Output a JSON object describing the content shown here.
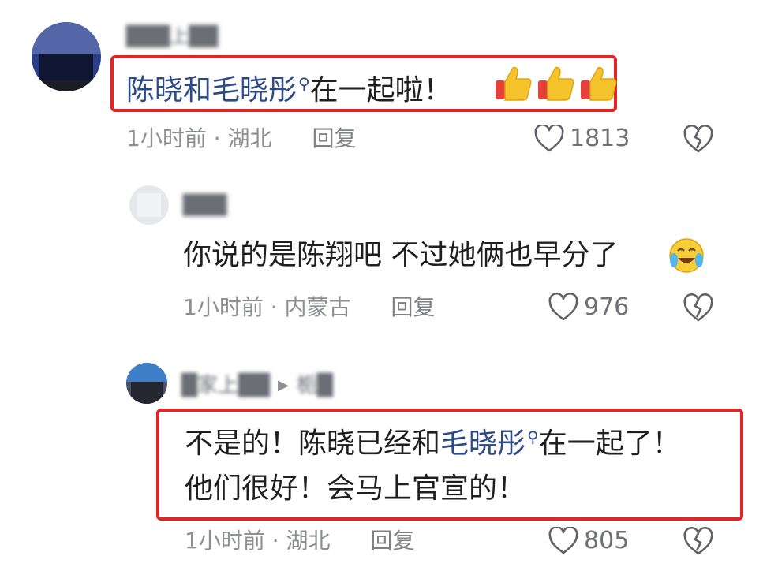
{
  "comments": [
    {
      "username": "███上██",
      "text_mention": "陈晓和毛晓彤",
      "text_rest": "在一起啦！",
      "emojis": [
        "thumbs-up",
        "thumbs-up",
        "thumbs-up"
      ],
      "time": "1小时前",
      "separator": "·",
      "location": "湖北",
      "reply_label": "回复",
      "likes": "1813"
    },
    {
      "username": "███",
      "text": "你说的是陈翔吧 不过她俩也早分了",
      "emoji": "laughing-crying",
      "time": "1小时前",
      "separator": "·",
      "location": "内蒙古",
      "reply_label": "回复",
      "likes": "976"
    },
    {
      "username": "█家上██",
      "reply_to_name": "栀█",
      "line1_a": "不是的！陈晓已经和",
      "line1_mention": "毛晓彤",
      "line1_b": "在一起了！",
      "line2": "他们很好！会马上官宣的！",
      "time": "1小时前",
      "separator": "·",
      "location": "湖北",
      "reply_label": "回复",
      "likes": "805"
    }
  ],
  "colors": {
    "highlight_border": "#e02525",
    "mention": "#2c4b86",
    "meta_text": "#8d8f94"
  },
  "icons": {
    "like": "heart-outline-icon",
    "dislike": "broken-heart-icon",
    "search_mark": "search-icon"
  }
}
